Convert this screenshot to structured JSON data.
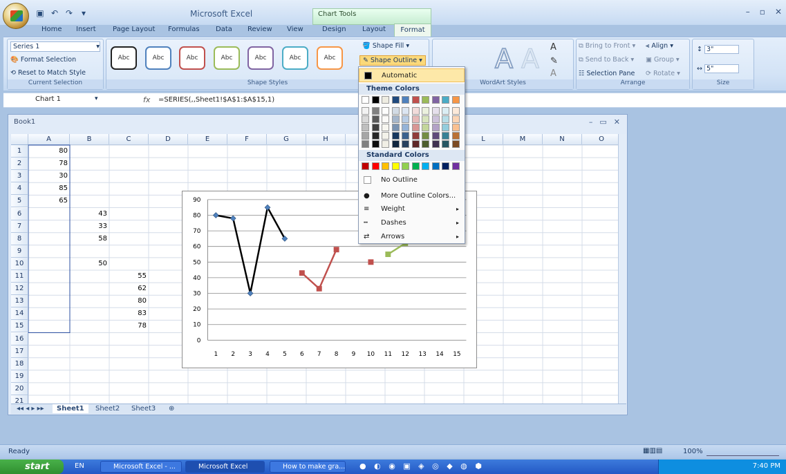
{
  "app": {
    "title": "Microsoft Excel",
    "contextual_tab": "Chart Tools"
  },
  "tabs": [
    "Home",
    "Insert",
    "Page Layout",
    "Formulas",
    "Data",
    "Review",
    "View",
    "Design",
    "Layout",
    "Format"
  ],
  "ribbon": {
    "current_selection": {
      "dropdown_value": "Series 1",
      "format_selection": "Format Selection",
      "reset": "Reset to Match Style",
      "label": "Current Selection"
    },
    "shape_styles": {
      "swatch_text": "Abc",
      "label": "Shape Styles",
      "shape_fill": "Shape Fill",
      "shape_outline": "Shape Outline"
    },
    "wordart": {
      "label": "WordArt Styles",
      "glyph": "A"
    },
    "arrange": {
      "bring_to_front": "Bring to Front",
      "send_to_back": "Send to Back",
      "selection_pane": "Selection Pane",
      "align": "Align",
      "group": "Group",
      "rotate": "Rotate",
      "label": "Arrange"
    },
    "size": {
      "height": "3\"",
      "width": "5\"",
      "label": "Size"
    }
  },
  "formula_bar": {
    "name_box": "Chart 1",
    "fx": "fx",
    "formula": "=SERIES(,,Sheet1!$A$1:$A$15,1)"
  },
  "workbook": {
    "title": "Book1",
    "sheets": [
      "Sheet1",
      "Sheet2",
      "Sheet3"
    ]
  },
  "columns": [
    "A",
    "B",
    "C",
    "D",
    "E",
    "F",
    "G",
    "H",
    "I",
    "J",
    "K",
    "L",
    "M",
    "N",
    "O"
  ],
  "rows": [
    "1",
    "2",
    "3",
    "4",
    "5",
    "6",
    "7",
    "8",
    "9",
    "10",
    "11",
    "12",
    "13",
    "14",
    "15",
    "16",
    "17",
    "18",
    "19",
    "20",
    "21"
  ],
  "cells": {
    "A": [
      "80",
      "78",
      "30",
      "85",
      "65",
      "",
      "",
      "",
      "",
      "",
      "",
      "",
      "",
      "",
      ""
    ],
    "B": [
      "",
      "",
      "",
      "",
      "",
      "43",
      "33",
      "58",
      "",
      "50",
      "",
      "",
      "",
      "",
      ""
    ],
    "C": [
      "",
      "",
      "",
      "",
      "",
      "",
      "",
      "",
      "",
      "",
      "55",
      "62",
      "80",
      "83",
      "78"
    ]
  },
  "dropdown": {
    "automatic": "Automatic",
    "theme_colors": "Theme Colors",
    "standard_colors": "Standard Colors",
    "no_outline": "No Outline",
    "more_colors": "More Outline Colors...",
    "weight": "Weight",
    "dashes": "Dashes",
    "arrows": "Arrows",
    "theme_top": [
      "#ffffff",
      "#000000",
      "#eeece1",
      "#1f497d",
      "#4f81bd",
      "#c0504d",
      "#9bbb59",
      "#8064a2",
      "#4bacc6",
      "#f79646"
    ],
    "standard": [
      "#c00000",
      "#ff0000",
      "#ffc000",
      "#ffff00",
      "#92d050",
      "#00b050",
      "#00b0f0",
      "#0070c0",
      "#002060",
      "#7030a0"
    ]
  },
  "status": {
    "text": "Ready",
    "zoom": "100%"
  },
  "taskbar": {
    "start": "start",
    "lang": "EN",
    "tasks": [
      "Microsoft Excel - ...",
      "Microsoft Excel",
      "How to make gra..."
    ],
    "clock": "7:40 PM"
  },
  "chart_data": {
    "type": "line",
    "x": [
      1,
      2,
      3,
      4,
      5,
      6,
      7,
      8,
      9,
      10,
      11,
      12,
      13,
      14,
      15
    ],
    "ylim": [
      0,
      90
    ],
    "yticks": [
      0,
      10,
      20,
      30,
      40,
      50,
      60,
      70,
      80,
      90
    ],
    "series": [
      {
        "color": "#000000",
        "marker": "#4f81bd",
        "points": [
          [
            1,
            80
          ],
          [
            2,
            78
          ],
          [
            3,
            30
          ],
          [
            4,
            85
          ],
          [
            5,
            65
          ]
        ]
      },
      {
        "color": "#c0504d",
        "marker": "#c0504d",
        "points": [
          [
            6,
            43
          ],
          [
            7,
            33
          ],
          [
            8,
            58
          ]
        ],
        "isolated": [
          [
            10,
            50
          ]
        ]
      },
      {
        "color": "#9bbb59",
        "marker": "#9bbb59",
        "points": [
          [
            11,
            55
          ],
          [
            12,
            62
          ]
        ]
      }
    ]
  }
}
